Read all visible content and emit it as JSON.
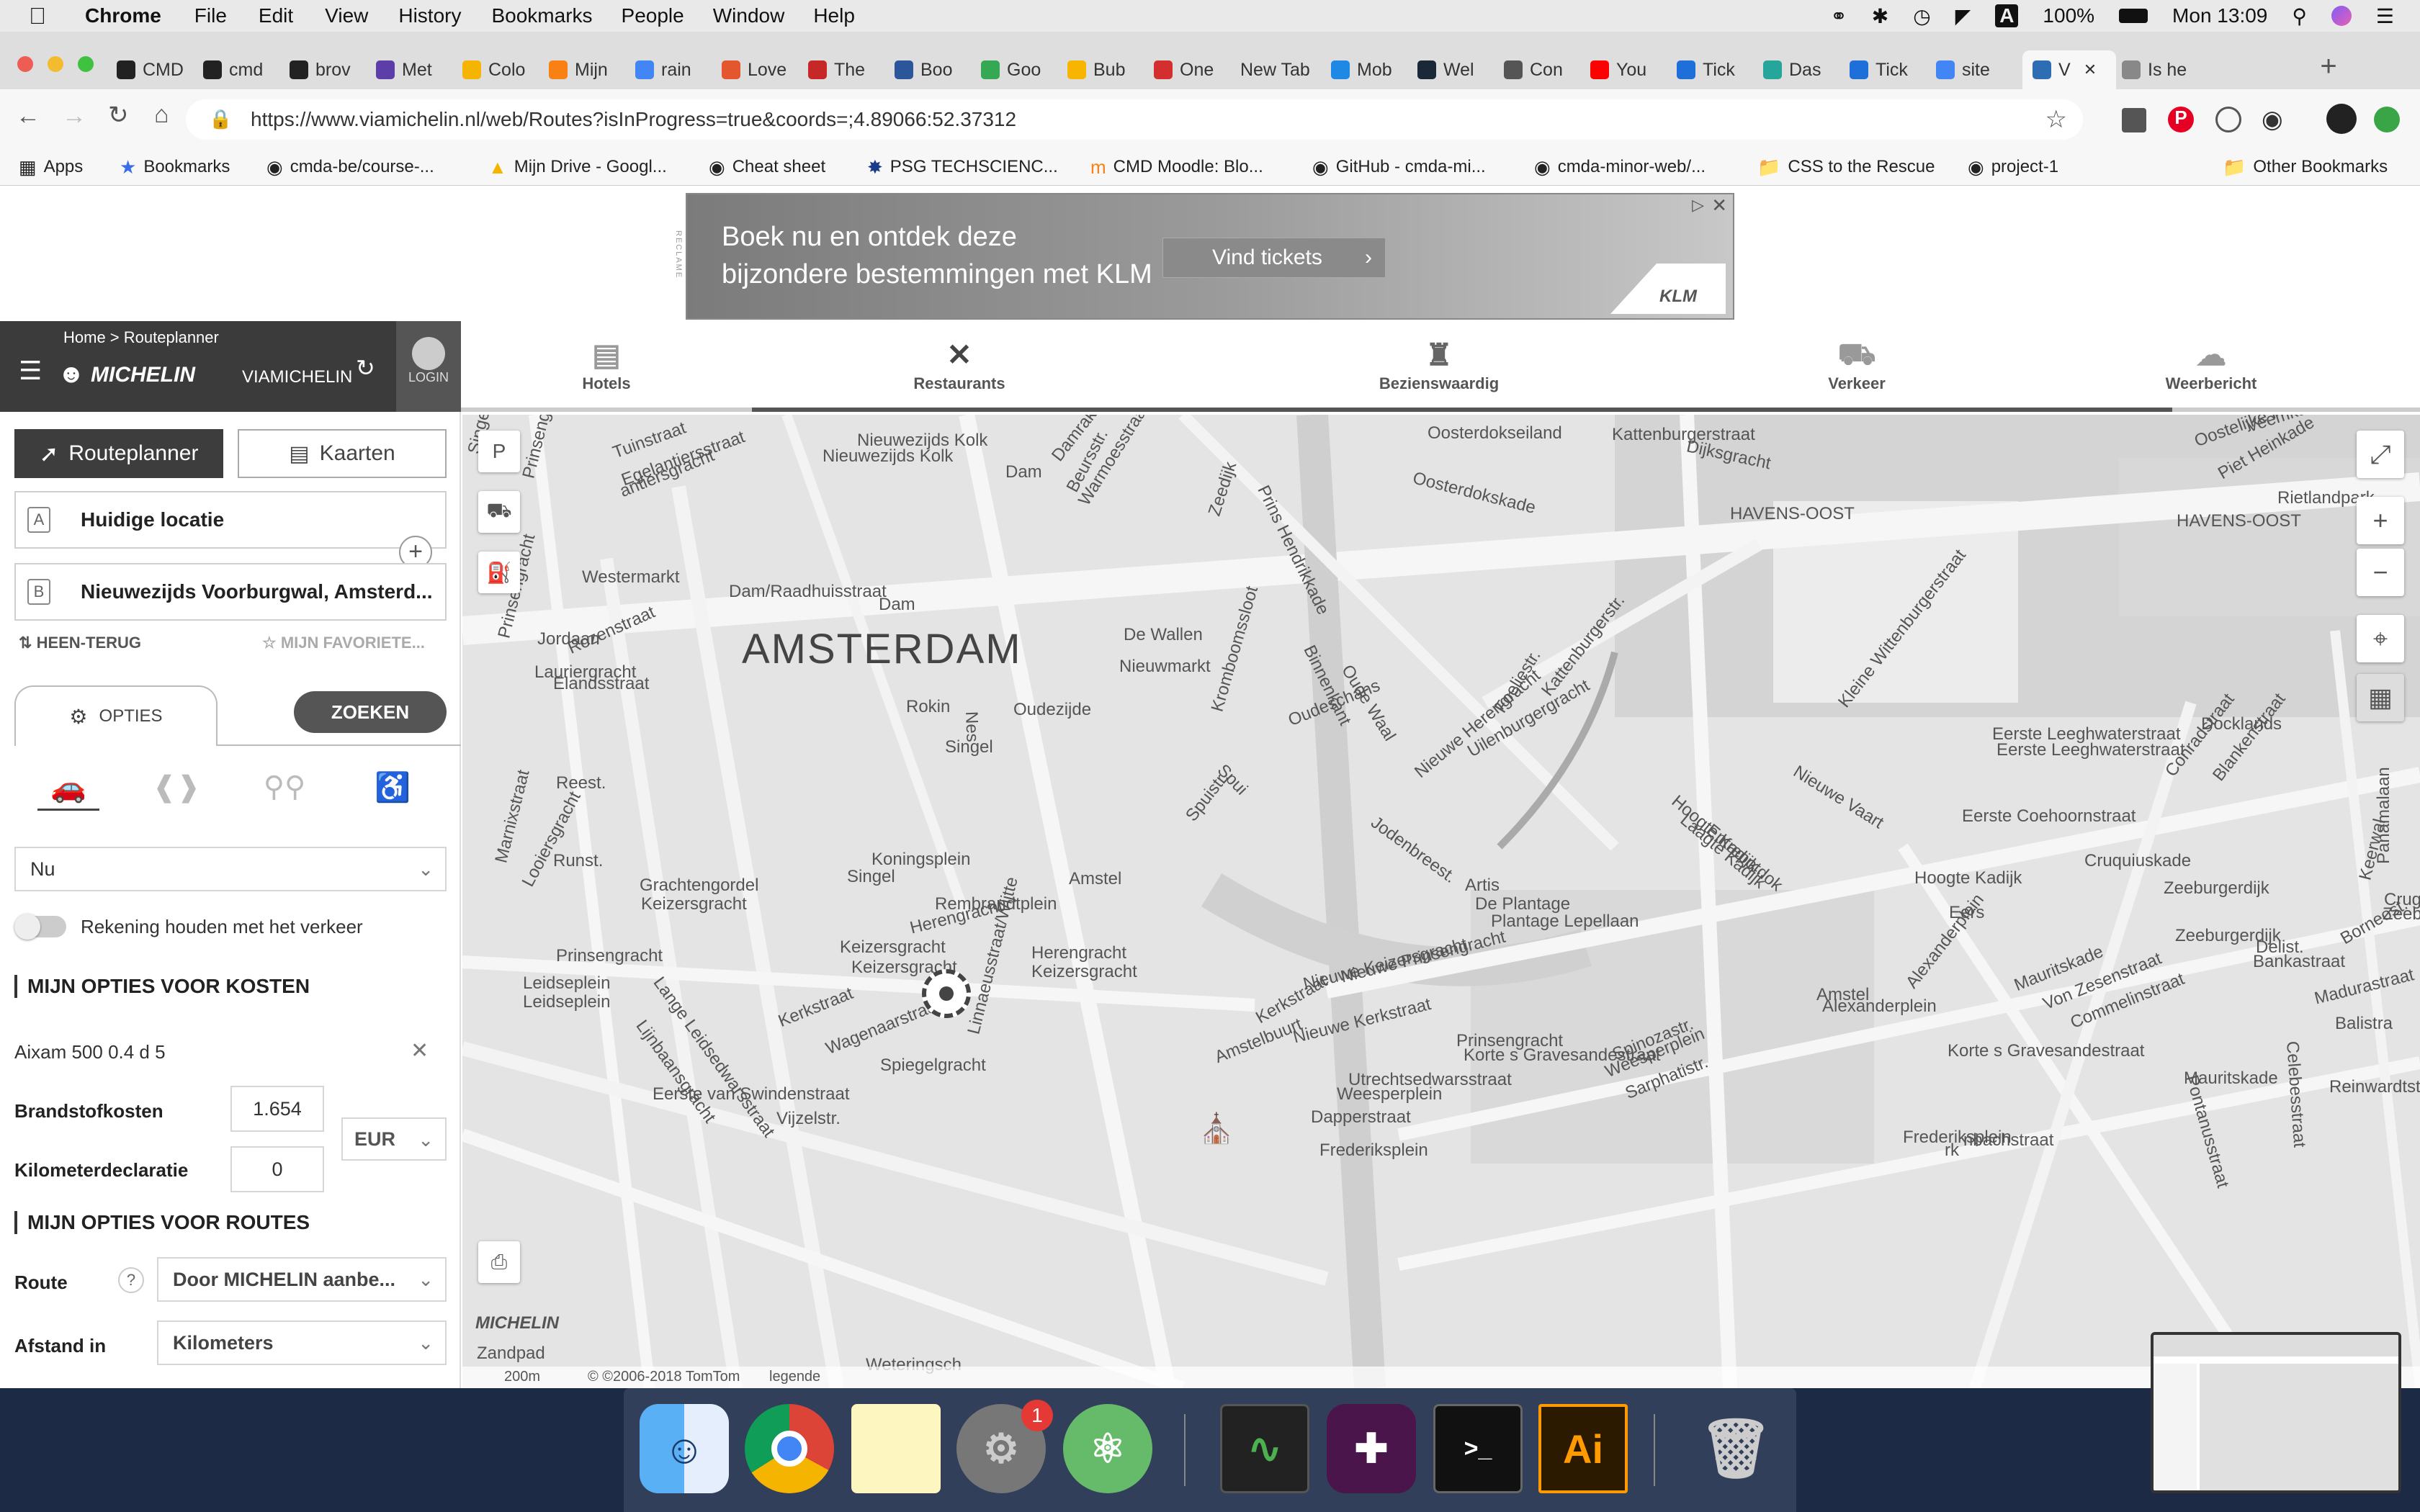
{
  "menubar": {
    "app_name": "Chrome",
    "menus": [
      "File",
      "Edit",
      "View",
      "History",
      "Bookmarks",
      "People",
      "Window",
      "Help"
    ],
    "battery": "100%",
    "clock": "Mon 13:09"
  },
  "tabs": [
    {
      "title": "CMD",
      "icon": "github-icon"
    },
    {
      "title": "cmd",
      "icon": "github-icon"
    },
    {
      "title": "brov",
      "icon": "github-icon"
    },
    {
      "title": "Met",
      "icon": "m-icon"
    },
    {
      "title": "Colo",
      "icon": "drive-icon"
    },
    {
      "title": "Mijn",
      "icon": "moodle-icon"
    },
    {
      "title": "rain",
      "icon": "google-icon"
    },
    {
      "title": "Love",
      "icon": "e-icon"
    },
    {
      "title": "The",
      "icon": "ato-icon"
    },
    {
      "title": "Boo",
      "icon": "w-icon"
    },
    {
      "title": "Goo",
      "icon": "maps-icon"
    },
    {
      "title": "Bub",
      "icon": "bubble-icon"
    },
    {
      "title": "One",
      "icon": "one-icon"
    },
    {
      "title": "New Tab",
      "icon": ""
    },
    {
      "title": "Mob",
      "icon": "edge-icon"
    },
    {
      "title": "Wel",
      "icon": "steam-icon"
    },
    {
      "title": "Con",
      "icon": "c-icon"
    },
    {
      "title": "You",
      "icon": "youtube-icon"
    },
    {
      "title": "Tick",
      "icon": "t-icon"
    },
    {
      "title": "Das",
      "icon": "tk-icon"
    },
    {
      "title": "Tick",
      "icon": "t-icon"
    },
    {
      "title": "site",
      "icon": "google-icon"
    },
    {
      "title": "V",
      "icon": "viamichelin-icon",
      "active": true
    },
    {
      "title": "Is he",
      "icon": "doc-icon"
    }
  ],
  "address_bar": {
    "url": "https://www.viamichelin.nl/web/Routes?isInProgress=true&coords=;4.89066:52.37312"
  },
  "bookmarks": [
    {
      "label": "Apps",
      "icon": "apps-grid-icon"
    },
    {
      "label": "Bookmarks",
      "icon": "star-icon"
    },
    {
      "label": "cmda-be/course-...",
      "icon": "github-icon"
    },
    {
      "label": "Mijn Drive - Googl...",
      "icon": "drive-icon"
    },
    {
      "label": "Cheat sheet",
      "icon": "github-icon"
    },
    {
      "label": "PSG TECHSCIENC...",
      "icon": "psg-icon"
    },
    {
      "label": "CMD Moodle: Blo...",
      "icon": "moodle-icon"
    },
    {
      "label": "GitHub - cmda-mi...",
      "icon": "github-icon"
    },
    {
      "label": "cmda-minor-web/...",
      "icon": "github-icon"
    },
    {
      "label": "CSS to the Rescue",
      "icon": "folder-icon"
    },
    {
      "label": "project-1",
      "icon": "github-icon"
    }
  ],
  "other_bookmarks": "Other Bookmarks",
  "ad": {
    "reclame": "RECLAME",
    "line1": "Boek nu en ontdek deze",
    "line2": "bijzondere bestemmingen met KLM",
    "cta": "Vind tickets",
    "brand": "KLM"
  },
  "sidebar": {
    "breadcrumb": "Home > Routeplanner",
    "logo": "MICHELIN",
    "logo_sub": "VIAMICHELIN",
    "login": "LOGIN",
    "tab_routeplanner": "Routeplanner",
    "tab_kaarten": "Kaarten",
    "point_a_letter": "A",
    "point_a": "Huidige locatie",
    "point_b_letter": "B",
    "point_b": "Nieuwezijds Voorburgwal, Amsterd...",
    "heen_terug": "HEEN-TERUG",
    "favorieten": "MIJN FAVORIETE...",
    "opties": "OPTIES",
    "zoeken": "ZOEKEN",
    "departure": "Nu",
    "traffic_toggle": "Rekening houden met het verkeer",
    "section_kosten": "MIJN OPTIES VOOR KOSTEN",
    "vehicle": "Aixam 500 0.4 d 5",
    "fuel_label": "Brandstofkosten",
    "fuel_value": "1.654",
    "currency": "EUR",
    "km_label": "Kilometerdeclaratie",
    "km_value": "0",
    "section_routes": "MIJN OPTIES VOOR ROUTES",
    "route_label": "Route",
    "route_help": "?",
    "route_value": "Door MICHELIN aanbe...",
    "distance_label": "Afstand in",
    "distance_value": "Kilometers"
  },
  "nav": [
    {
      "label": "Hotels",
      "icon": "bed-icon"
    },
    {
      "label": "Restaurants",
      "icon": "cutlery-icon"
    },
    {
      "label": "Bezienswaardig",
      "icon": "castle-icon"
    },
    {
      "label": "Verkeer",
      "icon": "car-icon"
    },
    {
      "label": "Weerbericht",
      "icon": "cloud-icon"
    }
  ],
  "map": {
    "city": "AMSTERDAM",
    "scale": "200m",
    "copyright": "© ©2006-2018 TomTom",
    "legend": "legende",
    "logo": "MICHELIN",
    "labels": [
      "Oosterdokseiland",
      "Kattenburgerstraat",
      "Oostelijke Han",
      "Veemkade",
      "Dijksgracht",
      "Piet Heinkade",
      "Rietlandpark",
      "HAVENS-OOST",
      "HAVENS-OOST",
      "Nieuwezijds Kolk",
      "Nieuwezijds Kolk",
      "Dam",
      "Damrak",
      "Beursstr.",
      "Warmoesstraat",
      "Zeedijk",
      "Prins Hendrikkade",
      "Oosterdokskade",
      "Westermarkt",
      "Dam/Raadhuisstraat",
      "Dam",
      "De Wallen",
      "Nieuwmarkt",
      "Binnenkant",
      "Oude Waal",
      "Jordaan",
      "Rozenstraat",
      "Rokin",
      "Nes",
      "Oudezijde",
      "Kromboomssloot",
      "Oudeschans",
      "Foeliestr.",
      "Uilenburgergracht",
      "Kattenburgerstr.",
      "Kleine Wittenburgerstraat",
      "Eerste Leeghwaterstraat",
      "Eerste Leeghwaterstraat",
      "Docklands",
      "Conradstraat",
      "Blankenstraat",
      "Spuistr.",
      "Spui",
      "Singel",
      "Jodenbreest.",
      "Nieuwe Herengracht",
      "Hoogte Kadijk",
      "Laagte Kadijk",
      "Entrepotdok",
      "Nieuwe Vaart",
      "Eerste Coehoornstraat",
      "Koningsplein",
      "Singel",
      "Amstel",
      "Rembrandtplein",
      "Artis",
      "De Plantage",
      "Plantage Lepellaan",
      "Hoogte Kadijk",
      "Cruquiuskade",
      "Zeeburgerdijk",
      "Grachtengordel",
      "Keizersgracht",
      "Prinsengracht",
      "Herengracht",
      "Keizersgracht",
      "Keizersgracht",
      "Herengracht",
      "Keizersgracht",
      "Leidseplein",
      "Leidseplein",
      "Kerkstraat",
      "Kerkstraat",
      "Nieuwe Keizersgracht",
      "Nieuwe Kerkstraat",
      "Nieuwe Prinsengracht",
      "Amstel",
      "Alexanderplein",
      "Alexanderplein",
      "Mauritskade",
      "Von Zesenstraat",
      "Commelinstraat",
      "Wagenaarstraat",
      "Prinsengracht",
      "Korte s Gravesandestraat",
      "Korte s Gravesandestraat",
      "Eerste van Swindenstraat",
      "Spiegelgracht",
      "Amstelbuurt",
      "Utrechtsedwarsstraat",
      "Weesperplein",
      "Weesperplein",
      "Sarphatistr.",
      "Spinozastr.",
      "Mauritskade",
      "Dapperstraat",
      "Frederiksplein",
      "Frederiksplein",
      "Linnaeusstraat/Wijtte",
      "Vijzelstr.",
      "Prinsengracht",
      "Lauriergracht",
      "Elandsstraat",
      "Reest.",
      "Runst.",
      "Looiersgracht",
      "Marnixstraat",
      "Lange Leidsedwarsstraat",
      "Lijnbaansgracht",
      "Zeeburgerdijk",
      "Delist.",
      "Bankastraat",
      "Madurastraat",
      "Balistra",
      "Borneost.",
      "Celebesstraat",
      "Pontanusstraat",
      "Reinwardtstr.",
      "Panamalaan",
      "Keerwal",
      "Eers",
      "Tuinstraat",
      "Egelantiersstraat",
      "antiersgracht",
      "Prinsengracht",
      "Singelgracht",
      "Zeebu",
      "Crug",
      "nbachstraat",
      "rk",
      "Weteringsch",
      "Zandpad"
    ]
  },
  "dock": [
    {
      "name": "Finder",
      "icon": "finder-icon"
    },
    {
      "name": "Chrome",
      "icon": "chrome-icon"
    },
    {
      "name": "Notes",
      "icon": "notes-icon"
    },
    {
      "name": "System Preferences",
      "icon": "settings-icon",
      "badge": "1"
    },
    {
      "name": "Atom",
      "icon": "atom-icon"
    },
    {
      "name": "Activity Monitor",
      "icon": "activity-icon"
    },
    {
      "name": "Slack",
      "icon": "slack-icon"
    },
    {
      "name": "Terminal",
      "icon": "terminal-icon",
      "text": ">_"
    },
    {
      "name": "Illustrator",
      "icon": "illustrator-icon",
      "text": "Ai"
    },
    {
      "name": "Trash",
      "icon": "trash-icon"
    }
  ],
  "colors": {
    "menubar": "#e9e9e9",
    "sidebar_header": "#3b3b3b",
    "button_dark": "#3d3d3d",
    "map_bg": "#e4e4e4",
    "dock_bg": "#4a5474",
    "desktop": "#1c2a45"
  }
}
